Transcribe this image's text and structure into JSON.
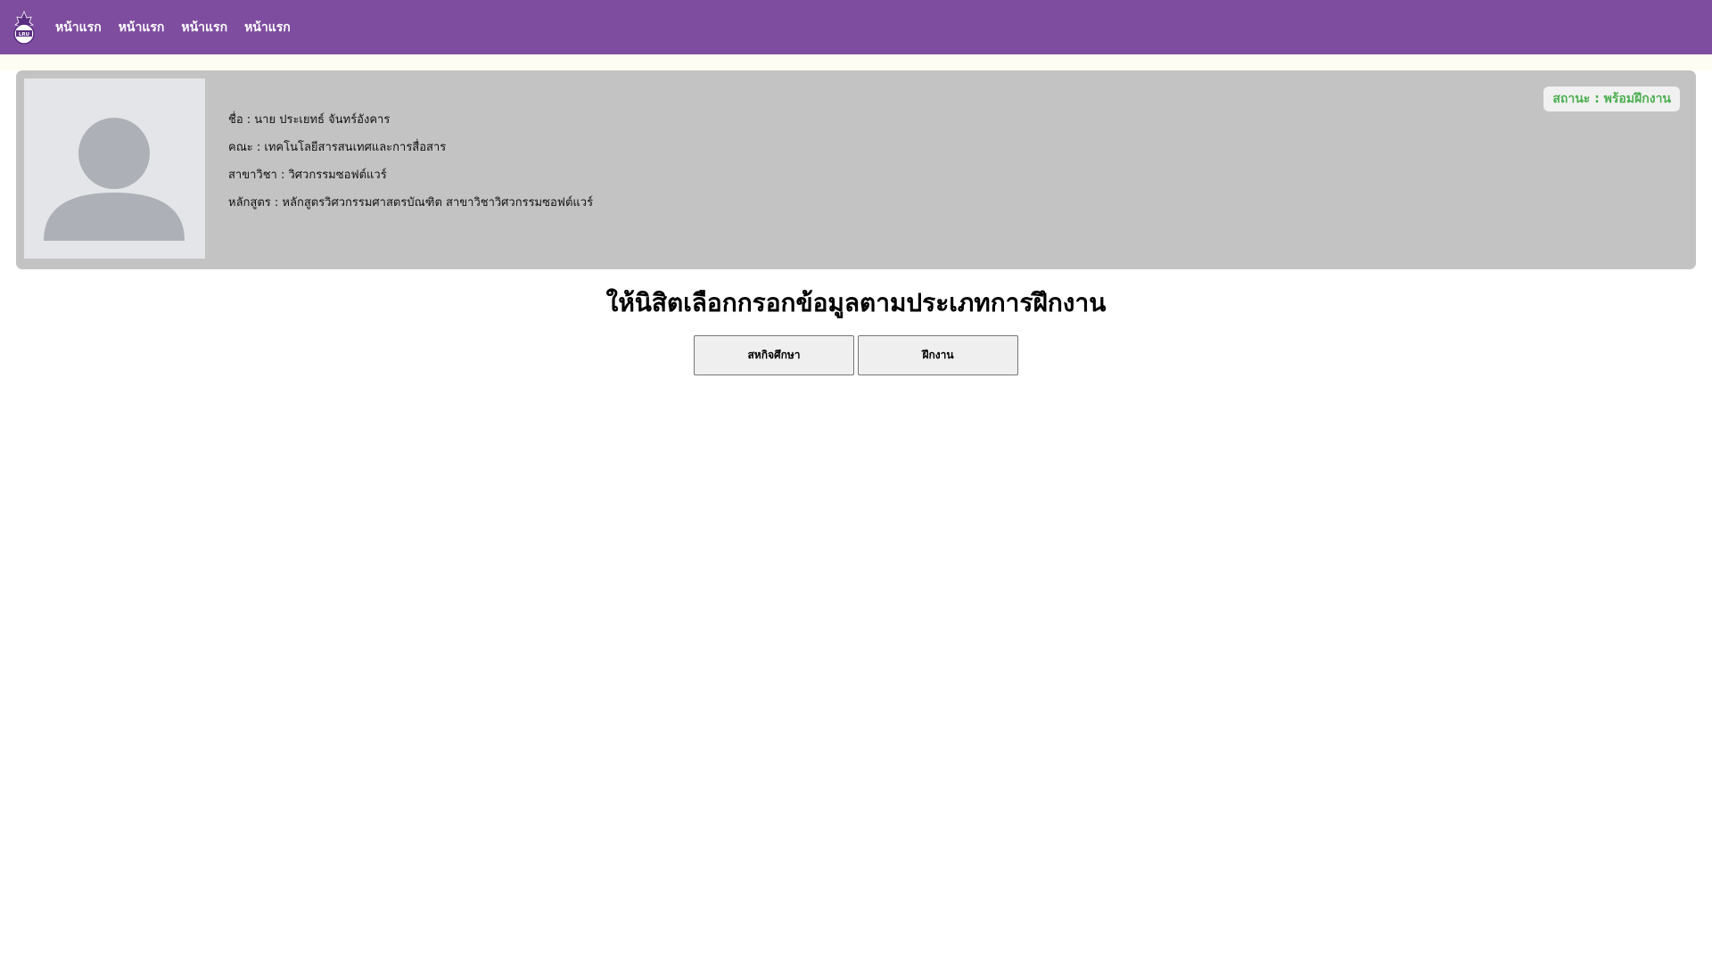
{
  "nav": {
    "items": [
      {
        "label": "หน้าแรก"
      },
      {
        "label": "หน้าแรก"
      },
      {
        "label": "หน้าแรก"
      },
      {
        "label": "หน้าแรก"
      }
    ],
    "logo_text": "LRU"
  },
  "profile": {
    "name_line": "ชื่อ : นาย ประเยทธ์ จันทร์อังคาร",
    "faculty_line": "คณะ : เทคโนโลยีสารสนเทศและการสื่อสาร",
    "major_line": "สาขาวิชา : วิศวกรรมซอฟต์แวร์",
    "curriculum_line": "หลักสูตร : หลักสูตรวิศวกรรมศาสตรบัณฑิต สาขาวิชาวิศวกรรมซอฟต์แวร์",
    "status": "สถานะ : พร้อมฝึกงาน"
  },
  "main": {
    "title": "ให้นิสิตเลือกกรอกข้อมูลตามประเภทการฝึกงาน",
    "buttons": {
      "coop": "สหกิจศึกษา",
      "internship": "ฝึกงาน"
    }
  },
  "colors": {
    "navbar": "#7e4d9f",
    "card": "#c3c3c3",
    "status_text": "#4caf50"
  }
}
